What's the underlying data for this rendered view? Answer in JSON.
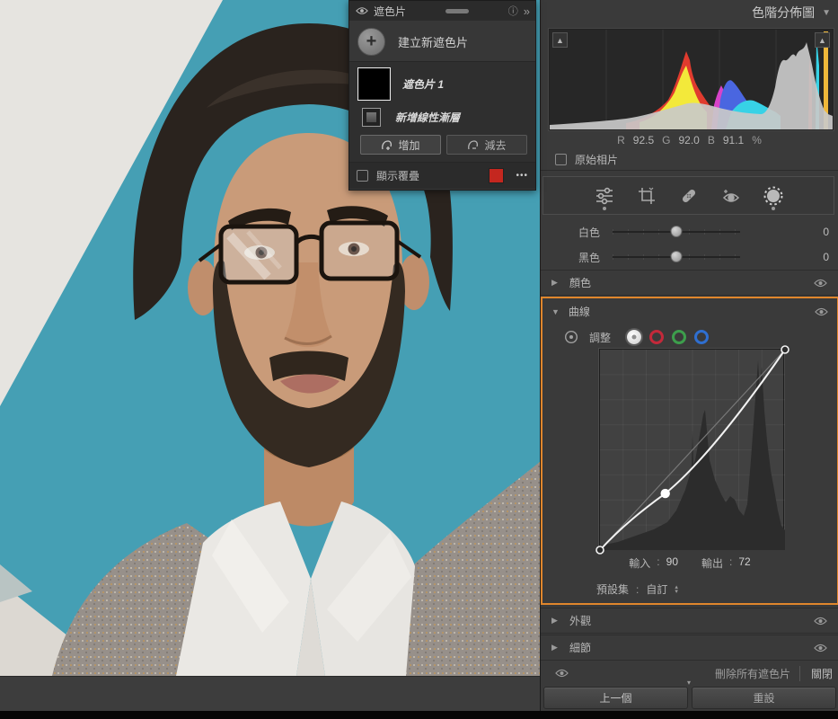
{
  "icons": {
    "triangle_down": "▼",
    "triangle_right": "▶",
    "triangle_up": "▲",
    "tiny_up": "▴",
    "tiny_down": "▾",
    "chevrons": "»",
    "info": "ⓘ",
    "dots": "•••",
    "plus": "+",
    "colon": ":"
  },
  "colors": {
    "accent_orange": "#e0862c",
    "overlay_swatch": "#c4271f",
    "teal_background": "#459fb4"
  },
  "mask_panel": {
    "title": "遮色片",
    "create_new_label": "建立新遮色片",
    "mask_name": "遮色片 1",
    "tool_name": "新增線性漸層",
    "add_button": "增加",
    "subtract_button": "減去",
    "overlay_label": "顯示覆疊"
  },
  "histogram_panel": {
    "title": "色階分佈圖",
    "rgb_readout": {
      "r_label": "R",
      "r_value": "92.5",
      "g_label": "G",
      "g_value": "92.0",
      "b_label": "B",
      "b_value": "91.1",
      "unit": "%"
    },
    "original_label": "原始相片"
  },
  "toolbar_icons": [
    "edit-sliders",
    "crop-rotate",
    "healing-brush",
    "red-eye",
    "masking"
  ],
  "sliders": {
    "whites": {
      "label": "白色",
      "value": "0"
    },
    "blacks": {
      "label": "黑色",
      "value": "0"
    }
  },
  "sections": {
    "color": {
      "label": "顏色"
    },
    "curve": {
      "label": "曲線"
    },
    "effects": {
      "label": "外觀"
    },
    "detail": {
      "label": "細節"
    }
  },
  "curve_panel": {
    "adjust_label": "調整",
    "input_label": "輸入",
    "input_value": "90",
    "output_label": "輸出",
    "output_value": "72",
    "preset_label": "預設集",
    "preset_value": "自訂",
    "point": {
      "input": 90,
      "output": 72
    },
    "channels": [
      "white",
      "red",
      "green",
      "blue"
    ]
  },
  "footer": {
    "delete_all_label": "刪除所有遮色片",
    "close_label": "關閉",
    "previous_button": "上一個",
    "reset_button": "重設"
  }
}
